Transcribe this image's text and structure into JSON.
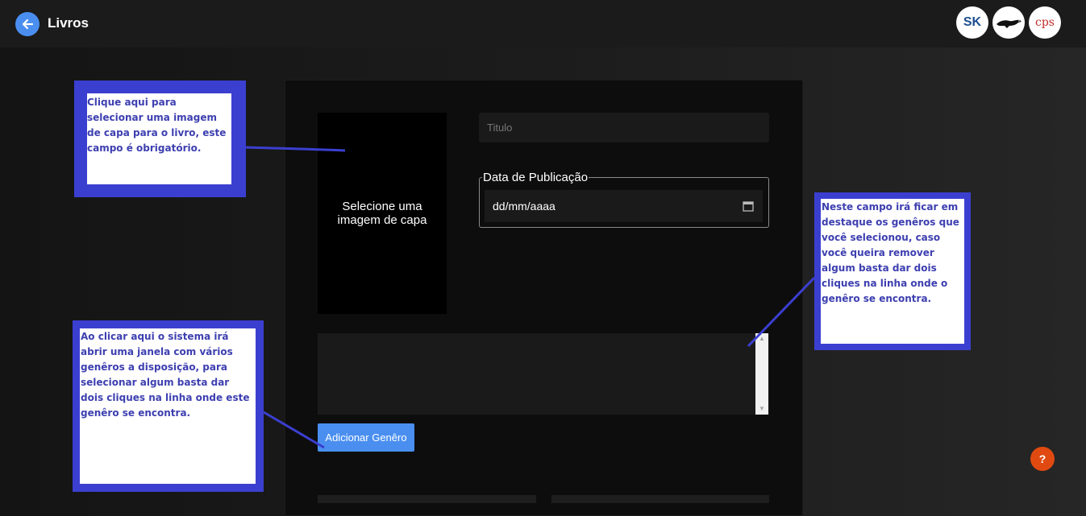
{
  "header": {
    "title": "Livros",
    "back_icon": "arrow-left-icon",
    "logos": [
      {
        "name": "logo-sk",
        "text": "SK"
      },
      {
        "name": "logo-animal",
        "text": ""
      },
      {
        "name": "logo-cps",
        "text": "cps"
      }
    ]
  },
  "form": {
    "cover_picker_label": "Selecione uma imagem de capa",
    "title_placeholder": "Titulo",
    "date_legend": "Data de Publicação",
    "date_value": "dd/mm/aaaa",
    "add_genre_label": "Adicionar Genêro"
  },
  "help_label": "?",
  "annotations": {
    "cover": "Clique aqui para selecionar uma imagem de capa para o livro, este campo é obrigatório.",
    "add_genre": "Ao clicar aqui o sistema irá abrir uma janela com vários genêros a disposição, para selecionar algum basta dar dois cliques na linha onde este genêro se encontra.",
    "genres_list": "Neste campo irá ficar em destaque os genêros que você selecionou, caso você queira remover algum basta dar dois cliques na linha onde o genêro se encontra."
  },
  "colors": {
    "accent": "#4a8ff0",
    "annotation_border": "#3b3fd0",
    "help": "#e04a10"
  }
}
